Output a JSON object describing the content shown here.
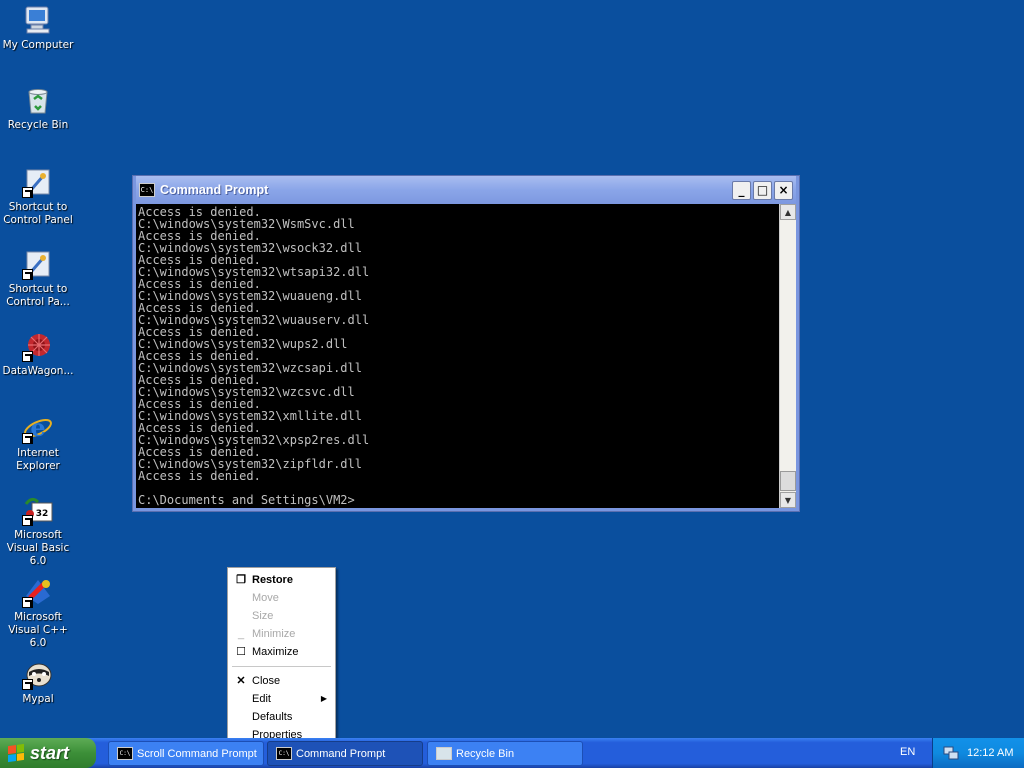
{
  "desktop": {
    "icons": [
      {
        "label": "My Computer",
        "icon": "my-computer-icon"
      },
      {
        "label": "Recycle Bin",
        "icon": "recycle-bin-icon"
      },
      {
        "label": "Shortcut to Control Panel",
        "icon": "control-panel-icon"
      },
      {
        "label": "Shortcut to Control Pa...",
        "icon": "control-panel-icon"
      },
      {
        "label": "DataWagon...",
        "icon": "datawagon-icon"
      },
      {
        "label": "Internet Explorer",
        "icon": "internet-explorer-icon"
      },
      {
        "label": "Microsoft Visual Basic 6.0",
        "icon": "visual-basic-icon"
      },
      {
        "label": "Microsoft Visual C++ 6.0",
        "icon": "visual-cpp-icon"
      },
      {
        "label": "Mypal",
        "icon": "mypal-icon"
      }
    ]
  },
  "cmd_window": {
    "title": "Command Prompt",
    "icon_text": "C:\\",
    "minimize": "_",
    "maximize": "□",
    "close": "×",
    "output": "Access is denied.\nC:\\windows\\system32\\WsmSvc.dll\nAccess is denied.\nC:\\windows\\system32\\wsock32.dll\nAccess is denied.\nC:\\windows\\system32\\wtsapi32.dll\nAccess is denied.\nC:\\windows\\system32\\wuaueng.dll\nAccess is denied.\nC:\\windows\\system32\\wuauserv.dll\nAccess is denied.\nC:\\windows\\system32\\wups2.dll\nAccess is denied.\nC:\\windows\\system32\\wzcsapi.dll\nAccess is denied.\nC:\\windows\\system32\\wzcsvc.dll\nAccess is denied.\nC:\\windows\\system32\\xmllite.dll\nAccess is denied.\nC:\\windows\\system32\\xpsp2res.dll\nAccess is denied.\nC:\\windows\\system32\\zipfldr.dll\nAccess is denied.\n\nC:\\Documents and Settings\\VM2>"
  },
  "context_menu": {
    "restore": "Restore",
    "move": "Move",
    "size": "Size",
    "minimize": "Minimize",
    "maximize": "Maximize",
    "close": "Close",
    "edit": "Edit",
    "defaults": "Defaults",
    "properties": "Properties"
  },
  "taskbar": {
    "start_label": "start",
    "buttons": [
      {
        "label": "Scroll Command Prompt",
        "icon": "cmd-icon"
      },
      {
        "label": "Command Prompt",
        "icon": "cmd-icon",
        "active": true
      },
      {
        "label": "Recycle Bin",
        "icon": "recycle-bin-icon"
      }
    ],
    "language": "EN",
    "clock": "12:12 AM"
  },
  "colors": {
    "desktop_bg": "#0a4f9e",
    "taskbar": "#245edb",
    "start_button": "#3c8f38",
    "title_bar_inactive": "#8aa5e8"
  }
}
